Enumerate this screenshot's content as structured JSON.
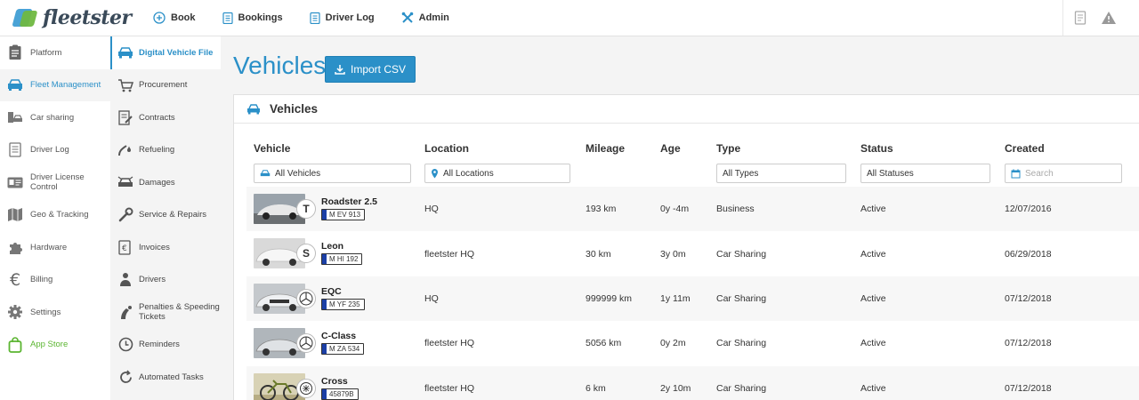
{
  "app": {
    "logo_text": "fleetster"
  },
  "topnav": [
    {
      "label": "Book",
      "icon": "plus-circle-icon"
    },
    {
      "label": "Bookings",
      "icon": "clipboard-icon"
    },
    {
      "label": "Driver Log",
      "icon": "clipboard-icon"
    },
    {
      "label": "Admin",
      "icon": "tools-icon"
    }
  ],
  "sidebar": {
    "items": [
      {
        "label": "Platform",
        "icon": "clipboard-icon"
      },
      {
        "label": "Fleet Management",
        "icon": "car-fleet-icon"
      },
      {
        "label": "Car sharing",
        "icon": "car-sharing-icon"
      },
      {
        "label": "Driver Log",
        "icon": "logbook-icon"
      },
      {
        "label": "Driver License Control",
        "icon": "id-card-icon"
      },
      {
        "label": "Geo & Tracking",
        "icon": "map-icon"
      },
      {
        "label": "Hardware",
        "icon": "puzzle-icon"
      },
      {
        "label": "Billing",
        "icon": "euro-icon"
      },
      {
        "label": "Settings",
        "icon": "gear-icon"
      },
      {
        "label": "App Store",
        "icon": "shopping-bag-icon"
      }
    ]
  },
  "subnav": {
    "items": [
      {
        "label": "Digital Vehicle File",
        "icon": "car-icon"
      },
      {
        "label": "Procurement",
        "icon": "cart-icon"
      },
      {
        "label": "Contracts",
        "icon": "contract-icon"
      },
      {
        "label": "Refueling",
        "icon": "fuel-icon"
      },
      {
        "label": "Damages",
        "icon": "damage-icon"
      },
      {
        "label": "Service & Repairs",
        "icon": "wrench-icon"
      },
      {
        "label": "Invoices",
        "icon": "invoice-icon"
      },
      {
        "label": "Drivers",
        "icon": "driver-icon"
      },
      {
        "label": "Penalties & Speeding Tickets",
        "icon": "penalty-icon"
      },
      {
        "label": "Reminders",
        "icon": "clock-icon"
      },
      {
        "label": "Automated Tasks",
        "icon": "refresh-icon"
      }
    ]
  },
  "main": {
    "title": "Vehicles",
    "import_label": "Import CSV",
    "panel_title": "Vehicles"
  },
  "table": {
    "headers": {
      "vehicle": "Vehicle",
      "location": "Location",
      "mileage": "Mileage",
      "age": "Age",
      "type": "Type",
      "status": "Status",
      "created": "Created"
    },
    "filters": {
      "vehicle": "All Vehicles",
      "location": "All Locations",
      "type": "All Types",
      "status": "All Statuses",
      "created_placeholder": "Search"
    },
    "rows": [
      {
        "name": "Roadster 2.5",
        "plate": "M EV 913",
        "brand": "tesla-logo-icon",
        "location": "HQ",
        "mileage": "193 km",
        "age": "0y -4m",
        "type": "Business",
        "status": "Active",
        "created": "12/07/2016"
      },
      {
        "name": "Leon",
        "plate": "M HI 192",
        "brand": "seat-logo-icon",
        "location": "fleetster HQ",
        "mileage": "30 km",
        "age": "3y 0m",
        "type": "Car Sharing",
        "status": "Active",
        "created": "06/29/2018"
      },
      {
        "name": "EQC",
        "plate": "M YF 235",
        "brand": "mercedes-logo-icon",
        "location": "HQ",
        "mileage": "999999 km",
        "age": "1y 11m",
        "type": "Car Sharing",
        "status": "Active",
        "created": "07/12/2018"
      },
      {
        "name": "C-Class",
        "plate": "M ZA 534",
        "brand": "mercedes-logo-icon",
        "location": "fleetster HQ",
        "mileage": "5056 km",
        "age": "0y 2m",
        "type": "Car Sharing",
        "status": "Active",
        "created": "07/12/2018"
      },
      {
        "name": "Cross",
        "plate": "45879B",
        "brand": "bike-brand-icon",
        "location": "fleetster HQ",
        "mileage": "6 km",
        "age": "2y 10m",
        "type": "Car Sharing",
        "status": "Active",
        "created": "07/12/2018"
      }
    ]
  },
  "colors": {
    "accent": "#2b90c8",
    "app_store": "#5bb531"
  }
}
